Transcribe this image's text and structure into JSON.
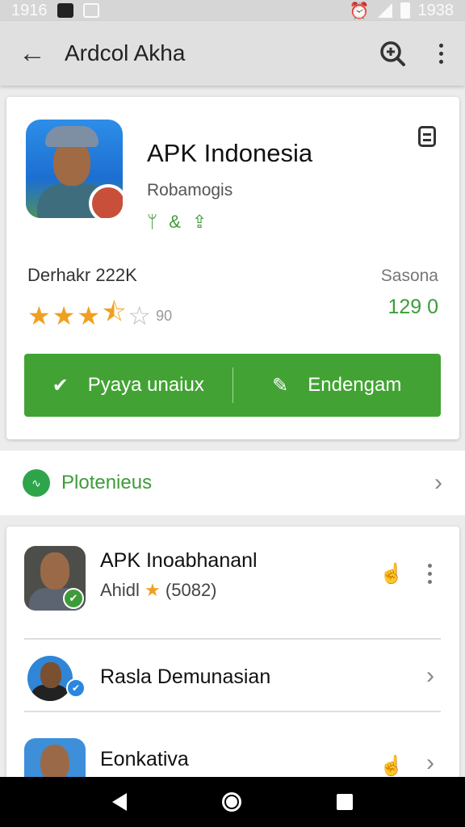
{
  "status_bar": {
    "time_left": "1916",
    "time_right": "1938"
  },
  "app_bar": {
    "title": "Ardcol Akha"
  },
  "app_card": {
    "name": "APK Indonesia",
    "developer": "Robamogis",
    "badge_icons": [
      "antenna-icon",
      "ampersand-icon",
      "share-icon"
    ],
    "downloads": "Derhakr 222K",
    "rating": 3.5,
    "rating_max": 5,
    "rating_count": "90",
    "size_label": "Sasona",
    "size_value": "129 0",
    "primary_button": "Pyaya unaiux",
    "secondary_button": "Endengam",
    "accent_color": "#42a334"
  },
  "section": {
    "label": "Plotenieus"
  },
  "list": [
    {
      "title": "APK Inoabhananl",
      "subtitle_name": "Ahidl",
      "subtitle_count": "(5082)"
    },
    {
      "title": "Rasla Demunasian"
    },
    {
      "title": "Eonkativa"
    }
  ]
}
